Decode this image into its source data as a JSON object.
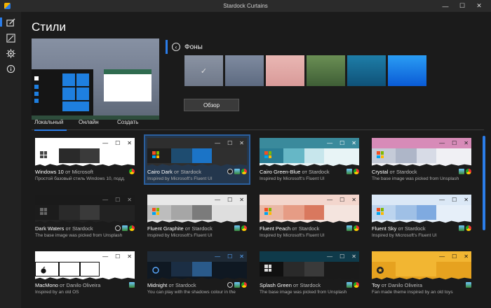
{
  "window": {
    "title": "Stardock Curtains",
    "minimize_icon": "minimize-icon",
    "maximize_icon": "maximize-icon",
    "close_icon": "close-icon"
  },
  "rail": {
    "items": [
      {
        "name": "styles",
        "icon": "edit-style-icon",
        "active": true
      },
      {
        "name": "editor",
        "icon": "create-icon"
      },
      {
        "name": "settings",
        "icon": "gear-icon"
      },
      {
        "name": "info",
        "icon": "info-icon"
      }
    ]
  },
  "page": {
    "title": "Стили"
  },
  "backgrounds": {
    "label": "Фоны",
    "browse_label": "Обзор",
    "items": [
      {
        "name": "selected-grey",
        "selected": true,
        "check": "✓",
        "color_top": "#8a93a3",
        "color_bottom": "#6f7889"
      },
      {
        "name": "blue-grey",
        "color_top": "#7f8ba0",
        "color_bottom": "#5d6a80"
      },
      {
        "name": "pink-sky",
        "color_top": "#e9b7b3",
        "color_bottom": "#d99a99"
      },
      {
        "name": "aerial-forest",
        "color_top": "#6b8f54",
        "color_bottom": "#3f5e36"
      },
      {
        "name": "ocean",
        "color_top": "#1e7ea8",
        "color_bottom": "#0f5278"
      },
      {
        "name": "blue-bloom",
        "color_top": "#2a9df4",
        "color_bottom": "#0a5bd6"
      }
    ]
  },
  "tabs": [
    {
      "label": "Локальный",
      "active": true
    },
    {
      "label": "Онлайн"
    },
    {
      "label": "Создать"
    }
  ],
  "styles": [
    {
      "name": "Windows 10",
      "by": "от Microsoft",
      "desc": "Простой базовый стиль Windows 10, подд…",
      "titlebar": "#ffffff",
      "ctrl_color": "#111",
      "tiles": [
        "#ffffff",
        "#2a2a2a",
        "#3a3a3a",
        "#ffffff"
      ],
      "logo": "#444",
      "badges": [
        "chrome"
      ],
      "selected": false
    },
    {
      "name": "Cairo Dark",
      "by": "от Stardock",
      "desc": "Inspired by Microsoft's Fluent UI",
      "titlebar": "#2e2e2e",
      "ctrl_color": "#ddd",
      "tiles": [
        "#1f1f1f",
        "#1e4c70",
        "#1b74c7",
        "#2f2f2f"
      ],
      "logo": "multi",
      "badges": [
        "moon",
        "img",
        "chrome"
      ],
      "selected": true
    },
    {
      "name": "Cairo Green-Blue",
      "by": "от Stardock",
      "desc": "Inspired by Microsoft's Fluent UI",
      "titlebar": "#3a8a9c",
      "ctrl_color": "#fff",
      "tiles": [
        "#2b7d94",
        "#66b7c6",
        "#c7e6ec",
        "#e8f4f6"
      ],
      "logo": "multi",
      "badges": [
        "img",
        "chrome"
      ],
      "selected": false
    },
    {
      "name": "Crystal",
      "by": "от Stardock",
      "desc": "The base image was picked from Unsplash",
      "titlebar": "#d78bb8",
      "ctrl_color": "#222",
      "tiles": [
        "#c5cbd8",
        "#aeb6c8",
        "#d7dbe6",
        "#f0f0f4"
      ],
      "logo": "multi",
      "badges": [
        "img",
        "chrome"
      ],
      "selected": false
    },
    {
      "name": "Dark Waters",
      "by": "от Stardock",
      "desc": "The base image was picked from Unsplash",
      "titlebar": "#1a1a1a",
      "ctrl_color": "#999",
      "tiles": [
        "#1c1c1c",
        "#2a2a2a",
        "#3a3a3a",
        "#222"
      ],
      "logo": "#666",
      "badges": [
        "moon",
        "img",
        "chrome"
      ],
      "selected": false
    },
    {
      "name": "Fluent Graphite",
      "by": "от Stardock",
      "desc": "Inspired by Microsoft's Fluent UI",
      "titlebar": "#e8e8e8",
      "ctrl_color": "#222",
      "tiles": [
        "#bdbdbd",
        "#a6a6a6",
        "#7b7b7b",
        "#dedede"
      ],
      "logo": "multi",
      "badges": [
        "img",
        "chrome"
      ],
      "selected": false
    },
    {
      "name": "Fluent Peach",
      "by": "от Stardock",
      "desc": "Inspired by Microsoft's Fluent UI",
      "titlebar": "#f3d6cd",
      "ctrl_color": "#222",
      "tiles": [
        "#eab7a5",
        "#e69c85",
        "#d9785e",
        "#f4e4de"
      ],
      "logo": "multi",
      "badges": [
        "img",
        "chrome"
      ],
      "selected": false
    },
    {
      "name": "Fluent Sky",
      "by": "от Stardock",
      "desc": "Inspired by Microsoft's Fluent UI",
      "titlebar": "#dbe8f6",
      "ctrl_color": "#222",
      "tiles": [
        "#bcd4ee",
        "#9fc0e6",
        "#7faae0",
        "#e6eff9"
      ],
      "logo": "multi",
      "badges": [
        "img",
        "chrome"
      ],
      "selected": false
    },
    {
      "name": "MacMono",
      "by": "от Danilo Oliveira",
      "desc": "Inspired by an old OS",
      "titlebar": "#ffffff",
      "ctrl_color": "#111",
      "tiles": [
        "#ffffff",
        "#ffffff",
        "#ffffff",
        "#ffffff"
      ],
      "logo": "apple",
      "badges": [
        "img"
      ],
      "selected": false
    },
    {
      "name": "Midnight",
      "by": "от Stardock",
      "desc": "You can play with the shadows colour in the",
      "titlebar": "#1f2a36",
      "ctrl_color": "#5aa9ff",
      "tiles": [
        "#0f1822",
        "#1b2e44",
        "#2a5a8a",
        "#0f1822"
      ],
      "logo": "moonblue",
      "badges": [
        "moon",
        "img",
        "chrome"
      ],
      "selected": false
    },
    {
      "name": "Splash Green",
      "by": "от Stardock",
      "desc": "The base image was picked from Unsplash",
      "titlebar": "#0f3a4a",
      "ctrl_color": "#ddd",
      "tiles": [
        "#101010",
        "#2a2a2a",
        "#3a3a3a",
        "#1a1a1a"
      ],
      "logo": "#ddd",
      "badges": [
        "img",
        "chrome"
      ],
      "selected": false
    },
    {
      "name": "Toy",
      "by": "от Danilo Oliveira",
      "desc": "Fan made theme inspired by an old toys",
      "titlebar": "#f2b632",
      "ctrl_color": "#111",
      "tiles": [
        "#e6a21f",
        "#f2b632",
        "#f2b632",
        "#e6a21f"
      ],
      "logo": "star",
      "badges": [
        "img"
      ],
      "selected": false
    }
  ]
}
